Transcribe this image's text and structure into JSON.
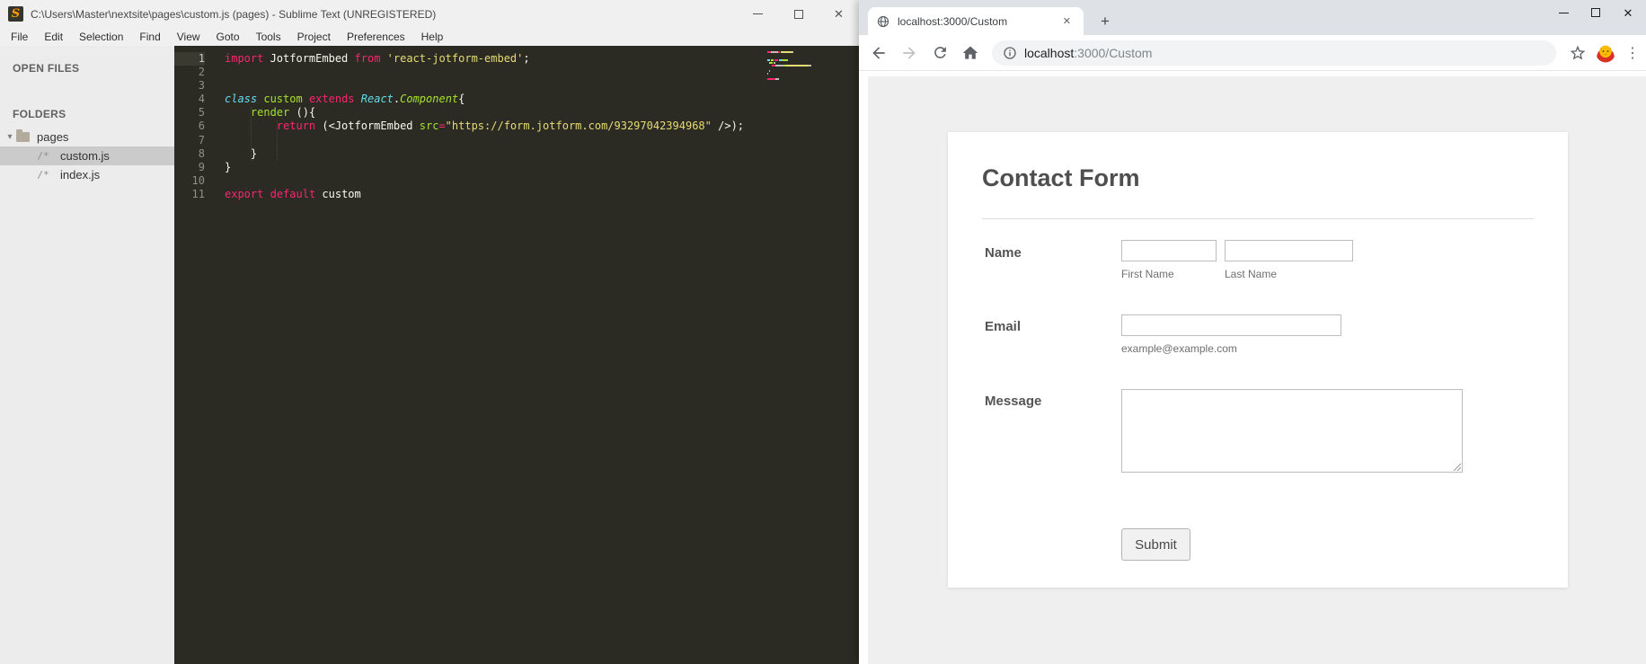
{
  "icons": {
    "sublime_logo": "S",
    "minimize": "—",
    "maximize": "▢",
    "close": "✕",
    "disclosure_down": "▾",
    "file_glyph": "/*",
    "new_tab": "+",
    "tab_close": "✕",
    "menu_dots": "⋮"
  },
  "colors": {
    "editor_bg": "#2b2b23",
    "keyword_pink": "#f92672",
    "string_yellow": "#e6db74",
    "foreground_white": "#f8f8f2",
    "type_cyan_italic": "#66d9ef",
    "entity_green": "#a6e22e",
    "tabbar_gray": "#dee1e6",
    "page_gray": "#efefef",
    "sublime_logo_orange": "#ff9d00"
  },
  "sublime": {
    "window_title": "C:\\Users\\Master\\nextsite\\pages\\custom.js (pages) - Sublime Text (UNREGISTERED)",
    "menu_items": [
      "File",
      "Edit",
      "Selection",
      "Find",
      "View",
      "Goto",
      "Tools",
      "Project",
      "Preferences",
      "Help"
    ],
    "sidebar": {
      "open_files_heading": "OPEN FILES",
      "folders_heading": "FOLDERS",
      "folder_name": "pages",
      "files": [
        {
          "name": "custom.js",
          "selected": true
        },
        {
          "name": "index.js",
          "selected": false
        }
      ]
    },
    "code_lines": [
      {
        "num": 1,
        "caret": true,
        "tokens": [
          [
            "kw",
            "import"
          ],
          [
            "fg",
            " JotformEmbed "
          ],
          [
            "kw",
            "from"
          ],
          [
            "fg",
            " "
          ],
          [
            "str",
            "'react-jotform-embed'"
          ],
          [
            "fg",
            ";"
          ]
        ]
      },
      {
        "num": 2,
        "tokens": []
      },
      {
        "num": 3,
        "tokens": []
      },
      {
        "num": 4,
        "tokens": [
          [
            "ti",
            "class"
          ],
          [
            "fg",
            " "
          ],
          [
            "en",
            "custom"
          ],
          [
            "fg",
            " "
          ],
          [
            "kw",
            "extends"
          ],
          [
            "fg",
            " "
          ],
          [
            "ti",
            "React"
          ],
          [
            "fg",
            "."
          ],
          [
            "eni",
            "Component"
          ],
          [
            "fg",
            "{"
          ]
        ]
      },
      {
        "num": 5,
        "tokens": [
          [
            "fg",
            "    "
          ],
          [
            "en",
            "render"
          ],
          [
            "fg",
            " (){"
          ]
        ]
      },
      {
        "num": 6,
        "tokens": [
          [
            "fg",
            "        "
          ],
          [
            "kw",
            "return"
          ],
          [
            "fg",
            " (<JotformEmbed "
          ],
          [
            "en",
            "src"
          ],
          [
            "kw",
            "="
          ],
          [
            "str",
            "\"https://form.jotform.com/93297042394968\""
          ],
          [
            "fg",
            " />);"
          ]
        ]
      },
      {
        "num": 7,
        "tokens": []
      },
      {
        "num": 8,
        "tokens": [
          [
            "fg",
            "    }"
          ]
        ]
      },
      {
        "num": 9,
        "tokens": [
          [
            "fg",
            "}"
          ]
        ]
      },
      {
        "num": 10,
        "tokens": []
      },
      {
        "num": 11,
        "tokens": [
          [
            "kw",
            "export"
          ],
          [
            "fg",
            " "
          ],
          [
            "kw",
            "default"
          ],
          [
            "fg",
            " custom"
          ]
        ]
      }
    ]
  },
  "browser": {
    "tab_title": "localhost:3000/Custom",
    "url_host": "localhost",
    "url_path": ":3000/Custom",
    "page": {
      "form_title": "Contact Form",
      "name_label": "Name",
      "first_name_sublabel": "First Name",
      "last_name_sublabel": "Last Name",
      "email_label": "Email",
      "email_hint": "example@example.com",
      "message_label": "Message",
      "submit_label": "Submit"
    }
  }
}
